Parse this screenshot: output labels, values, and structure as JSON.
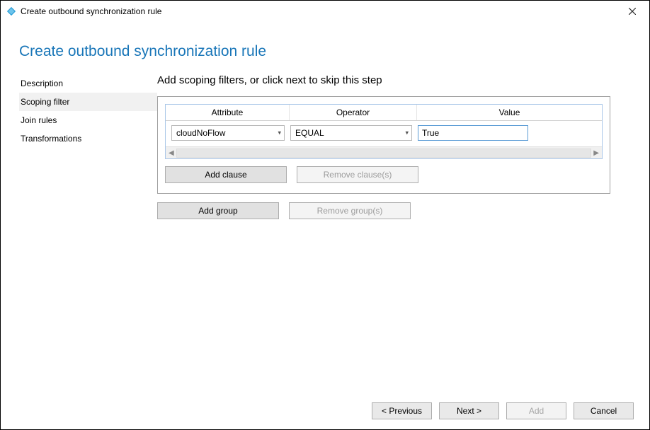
{
  "window": {
    "title": "Create outbound synchronization rule"
  },
  "heading": "Create outbound synchronization rule",
  "sidebar": {
    "items": [
      {
        "label": "Description"
      },
      {
        "label": "Scoping filter"
      },
      {
        "label": "Join rules"
      },
      {
        "label": "Transformations"
      }
    ],
    "active_index": 1
  },
  "step_title": "Add scoping filters, or click next to skip this step",
  "filter": {
    "headers": {
      "attribute": "Attribute",
      "operator": "Operator",
      "value": "Value"
    },
    "row": {
      "attribute": "cloudNoFlow",
      "operator": "EQUAL",
      "value": "True"
    }
  },
  "buttons": {
    "add_clause": "Add clause",
    "remove_clause": "Remove clause(s)",
    "add_group": "Add group",
    "remove_group": "Remove group(s)"
  },
  "footer": {
    "previous": "< Previous",
    "next": "Next >",
    "add": "Add",
    "cancel": "Cancel"
  }
}
